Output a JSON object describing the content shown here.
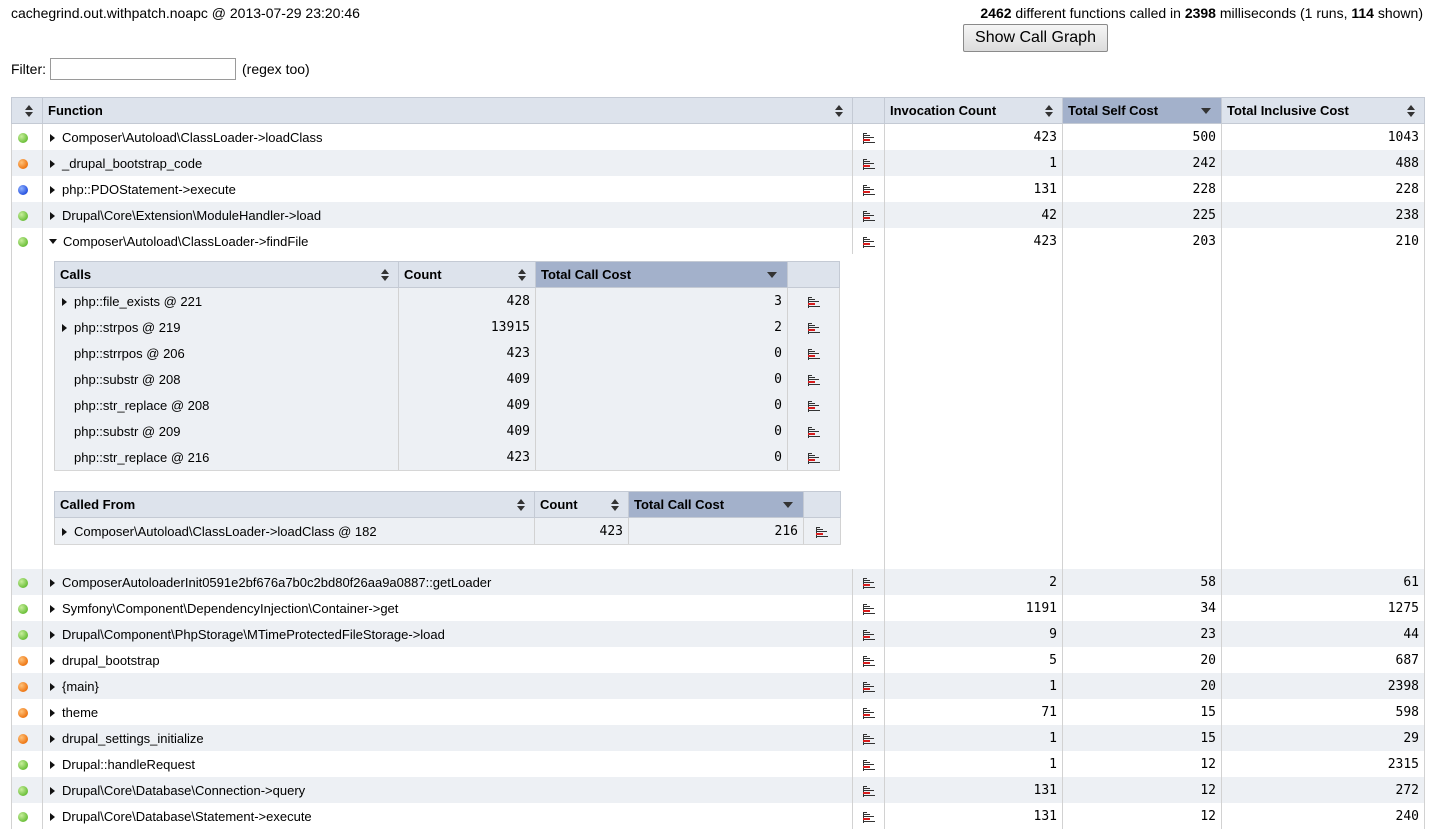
{
  "header": {
    "title": "cachegrind.out.withpatch.noapc @ 2013-07-29 23:20:46",
    "summary": {
      "functions_count": "2462",
      "text1": " different functions called in ",
      "milliseconds": "2398",
      "text2": " milliseconds (1 runs, ",
      "shown_count": "114",
      "text3": " shown)"
    },
    "call_graph_button": "Show Call Graph"
  },
  "filter": {
    "label": "Filter:",
    "value": "",
    "hint": "(regex too)"
  },
  "columns": {
    "function": "Function",
    "invocation_count": "Invocation Count",
    "total_self_cost": "Total Self Cost",
    "total_inclusive_cost": "Total Inclusive Cost"
  },
  "functions_top": [
    {
      "status": "green",
      "name": "Composer\\Autoload\\ClassLoader->loadClass",
      "invocations": "423",
      "self": "500",
      "inclusive": "1043"
    },
    {
      "status": "orange",
      "name": "_drupal_bootstrap_code",
      "invocations": "1",
      "self": "242",
      "inclusive": "488"
    },
    {
      "status": "blue",
      "name": "php::PDOStatement->execute",
      "invocations": "131",
      "self": "228",
      "inclusive": "228"
    },
    {
      "status": "green",
      "name": "Drupal\\Core\\Extension\\ModuleHandler->load",
      "invocations": "42",
      "self": "225",
      "inclusive": "238"
    }
  ],
  "expanded_function": {
    "status": "green",
    "name": "Composer\\Autoload\\ClassLoader->findFile",
    "invocations": "423",
    "self": "203",
    "inclusive": "210",
    "calls": {
      "headers": {
        "calls": "Calls",
        "count": "Count",
        "total_call_cost": "Total Call Cost"
      },
      "rows": [
        {
          "expandable": true,
          "name": "php::file_exists @ 221",
          "count": "428",
          "cost": "3"
        },
        {
          "expandable": true,
          "name": "php::strpos @ 219",
          "count": "13915",
          "cost": "2"
        },
        {
          "expandable": false,
          "name": "php::strrpos @ 206",
          "count": "423",
          "cost": "0"
        },
        {
          "expandable": false,
          "name": "php::substr @ 208",
          "count": "409",
          "cost": "0"
        },
        {
          "expandable": false,
          "name": "php::str_replace @ 208",
          "count": "409",
          "cost": "0"
        },
        {
          "expandable": false,
          "name": "php::substr @ 209",
          "count": "409",
          "cost": "0"
        },
        {
          "expandable": false,
          "name": "php::str_replace @ 216",
          "count": "423",
          "cost": "0"
        }
      ]
    },
    "called_from": {
      "headers": {
        "called_from": "Called From",
        "count": "Count",
        "total_call_cost": "Total Call Cost"
      },
      "rows": [
        {
          "expandable": true,
          "name": "Composer\\Autoload\\ClassLoader->loadClass @ 182",
          "count": "423",
          "cost": "216"
        }
      ]
    }
  },
  "functions_bottom": [
    {
      "status": "green",
      "name": "ComposerAutoloaderInit0591e2bf676a7b0c2bd80f26aa9a0887::getLoader",
      "invocations": "2",
      "self": "58",
      "inclusive": "61"
    },
    {
      "status": "green",
      "name": "Symfony\\Component\\DependencyInjection\\Container->get",
      "invocations": "1191",
      "self": "34",
      "inclusive": "1275"
    },
    {
      "status": "green",
      "name": "Drupal\\Component\\PhpStorage\\MTimeProtectedFileStorage->load",
      "invocations": "9",
      "self": "23",
      "inclusive": "44"
    },
    {
      "status": "orange",
      "name": "drupal_bootstrap",
      "invocations": "5",
      "self": "20",
      "inclusive": "687"
    },
    {
      "status": "orange",
      "name": "{main}",
      "invocations": "1",
      "self": "20",
      "inclusive": "2398"
    },
    {
      "status": "orange",
      "name": "theme",
      "invocations": "71",
      "self": "15",
      "inclusive": "598"
    },
    {
      "status": "orange",
      "name": "drupal_settings_initialize",
      "invocations": "1",
      "self": "15",
      "inclusive": "29"
    },
    {
      "status": "green",
      "name": "Drupal::handleRequest",
      "invocations": "1",
      "self": "12",
      "inclusive": "2315"
    },
    {
      "status": "green",
      "name": "Drupal\\Core\\Database\\Connection->query",
      "invocations": "131",
      "self": "12",
      "inclusive": "272"
    },
    {
      "status": "green",
      "name": "Drupal\\Core\\Database\\Statement->execute",
      "invocations": "131",
      "self": "12",
      "inclusive": "240"
    }
  ]
}
